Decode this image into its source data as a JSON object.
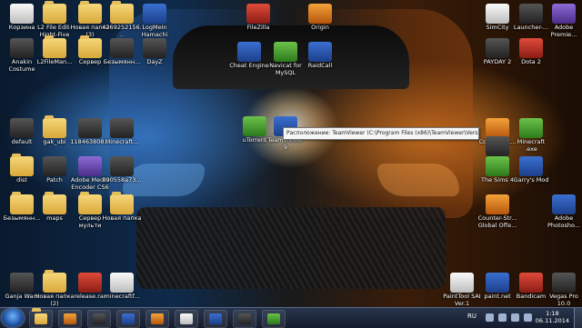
{
  "desktop_icons": [
    {
      "label": "Корзина",
      "kind": "white",
      "icon": "recycle-bin-icon"
    },
    {
      "label": "L2 File Edit-Hight-Five",
      "kind": "folder",
      "icon": "folder-icon"
    },
    {
      "label": "Новая папка (3)",
      "kind": "folder",
      "icon": "folder-icon"
    },
    {
      "label": "4269252156...",
      "kind": "folder",
      "icon": "folder-icon"
    },
    {
      "label": "LogMeIn Hamachi",
      "kind": "app",
      "icon": "hamachi-icon"
    },
    {
      "label": "FileZilla",
      "kind": "red",
      "icon": "filezilla-icon"
    },
    {
      "label": "Origin",
      "kind": "orange",
      "icon": "origin-icon"
    },
    {
      "label": "SimCity",
      "kind": "white",
      "icon": "simcity-icon"
    },
    {
      "label": "Launcher-...",
      "kind": "dark",
      "icon": "launcher-icon"
    },
    {
      "label": "Adobe Premie...",
      "kind": "purple",
      "icon": "premiere-icon"
    },
    {
      "label": "Anakin Costume",
      "kind": "dark",
      "icon": "image-icon"
    },
    {
      "label": "L2FileMan...",
      "kind": "folder",
      "icon": "folder-icon"
    },
    {
      "label": "Сервер",
      "kind": "folder",
      "icon": "folder-icon"
    },
    {
      "label": "Безымянн...",
      "kind": "dark",
      "icon": "file-icon"
    },
    {
      "label": "DayZ",
      "kind": "dark",
      "icon": "dayz-icon"
    },
    {
      "label": "Cheat Engine",
      "kind": "app",
      "icon": "cheat-engine-icon"
    },
    {
      "label": "Navicat for MySQL",
      "kind": "green",
      "icon": "navicat-icon"
    },
    {
      "label": "RaidCall",
      "kind": "app",
      "icon": "raidcall-icon"
    },
    {
      "label": "PAYDAY 2",
      "kind": "dark",
      "icon": "payday-icon"
    },
    {
      "label": "Dota 2",
      "kind": "red",
      "icon": "dota-icon"
    },
    {
      "label": "default",
      "kind": "dark",
      "icon": "file-icon"
    },
    {
      "label": "gak_ubi",
      "kind": "folder",
      "icon": "folder-icon"
    },
    {
      "label": "118463808...",
      "kind": "dark",
      "icon": "image-icon"
    },
    {
      "label": "Minecraft...",
      "kind": "dark",
      "icon": "minecraft-icon"
    },
    {
      "label": "uTorrent",
      "kind": "green",
      "icon": "utorrent-icon"
    },
    {
      "label": "TeamViewer 9",
      "kind": "app",
      "icon": "teamviewer-icon"
    },
    {
      "label": "Counter-St...",
      "kind": "orange",
      "icon": "counter-strike-icon"
    },
    {
      "label": "GTA SA",
      "kind": "dark",
      "icon": "gta-icon"
    },
    {
      "label": "Minecraft .exe",
      "kind": "green",
      "icon": "minecraft-icon"
    },
    {
      "label": "dist",
      "kind": "folder",
      "icon": "folder-icon"
    },
    {
      "label": "Patch",
      "kind": "dark",
      "icon": "file-icon"
    },
    {
      "label": "Adobe Media Encoder CS6",
      "kind": "purple",
      "icon": "media-encoder-icon"
    },
    {
      "label": "890558a73...",
      "kind": "dark",
      "icon": "image-icon"
    },
    {
      "label": "The Sims 4",
      "kind": "green",
      "icon": "sims-icon"
    },
    {
      "label": "Garry's Mod",
      "kind": "app",
      "icon": "garrysmod-icon"
    },
    {
      "label": "Безымянн...",
      "kind": "folder",
      "icon": "folder-icon"
    },
    {
      "label": "maps",
      "kind": "folder",
      "icon": "folder-icon"
    },
    {
      "label": "Сервер мульти",
      "kind": "folder",
      "icon": "folder-icon"
    },
    {
      "label": "Новая папка",
      "kind": "folder",
      "icon": "folder-icon"
    },
    {
      "label": "Counter-Str... Global Offe...",
      "kind": "orange",
      "icon": "csgo-icon"
    },
    {
      "label": "Adobe Photosho...",
      "kind": "app",
      "icon": "photoshop-icon"
    },
    {
      "label": "Ganja Wars",
      "kind": "dark",
      "icon": "game-icon"
    },
    {
      "label": "Новая папка (2)",
      "kind": "folder",
      "icon": "folder-icon"
    },
    {
      "label": "release.rar",
      "kind": "red",
      "icon": "rar-icon"
    },
    {
      "label": "minecraftf...",
      "kind": "white",
      "icon": "file-icon"
    },
    {
      "label": "PaintTool SAI Ver.1",
      "kind": "white",
      "icon": "painttool-icon"
    },
    {
      "label": "paint.net",
      "kind": "app",
      "icon": "paintnet-icon"
    },
    {
      "label": "Bandicam",
      "kind": "red",
      "icon": "bandicam-icon"
    },
    {
      "label": "Vegas Pro 10.0",
      "kind": "dark",
      "icon": "vegas-icon"
    }
  ],
  "tooltip": {
    "text": "Расположение: TeamViewer (C:\\Program Files (x86)\\TeamViewer\\Version9)"
  },
  "taskbar": {
    "pinned": [
      {
        "icon": "explorer-icon",
        "kind": "folder"
      },
      {
        "icon": "media-player-icon",
        "kind": "orange"
      },
      {
        "icon": "steam-icon",
        "kind": "dark"
      },
      {
        "icon": "skype-icon",
        "kind": "app"
      },
      {
        "icon": "chat-icon",
        "kind": "orange"
      },
      {
        "icon": "window-icon",
        "kind": "white"
      },
      {
        "icon": "monitor-icon",
        "kind": "app"
      },
      {
        "icon": "console-icon",
        "kind": "dark"
      },
      {
        "icon": "chrome-icon",
        "kind": "green"
      }
    ],
    "language": "RU",
    "time": "1:18",
    "date": "06.11.2014"
  }
}
